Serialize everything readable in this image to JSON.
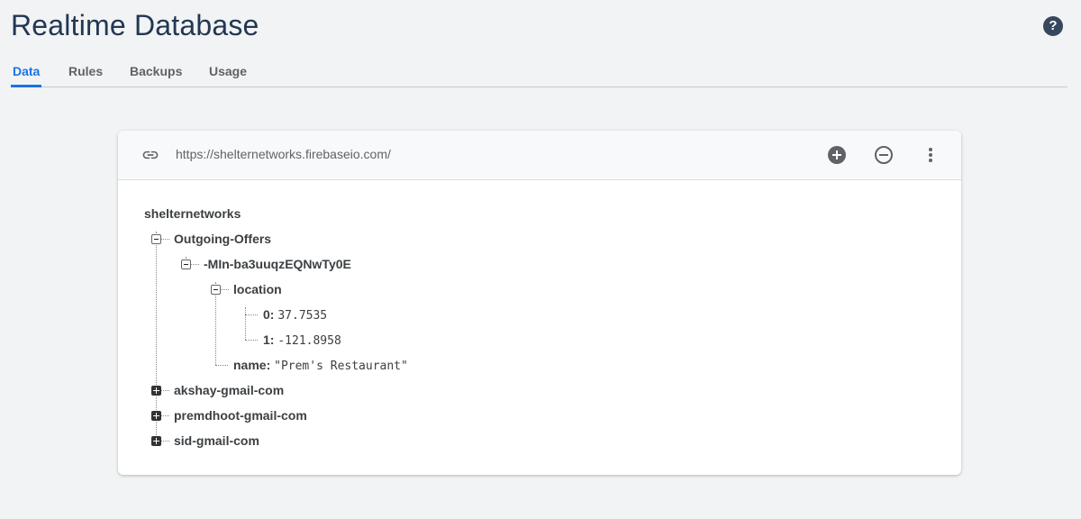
{
  "header": {
    "title": "Realtime Database",
    "help_icon": "help-circle-icon"
  },
  "tabs": [
    {
      "label": "Data",
      "active": true
    },
    {
      "label": "Rules",
      "active": false
    },
    {
      "label": "Backups",
      "active": false
    },
    {
      "label": "Usage",
      "active": false
    }
  ],
  "toolbar": {
    "url": "https://shelternetworks.firebaseio.com/",
    "link_icon": "link-icon",
    "add_icon": "add-circle-icon",
    "remove_icon": "remove-circle-icon",
    "more_icon": "more-vert-icon"
  },
  "tree": {
    "root": "shelternetworks",
    "outgoing_offers": "Outgoing-Offers",
    "offer_id": "-MIn-ba3uuqzEQNwTy0E",
    "location_key": "location",
    "loc_0_key": "0:",
    "loc_0_value": "37.7535",
    "loc_1_key": "1:",
    "loc_1_value": "-121.8958",
    "name_key": "name:",
    "name_value": "\"Prem's Restaurant\"",
    "akshay": "akshay-gmail-com",
    "premdhoot": "premdhoot-gmail-com",
    "sid": "sid-gmail-com"
  },
  "colors": {
    "accent": "#1a73e8",
    "title": "#223752",
    "background": "#f1f3f4"
  }
}
